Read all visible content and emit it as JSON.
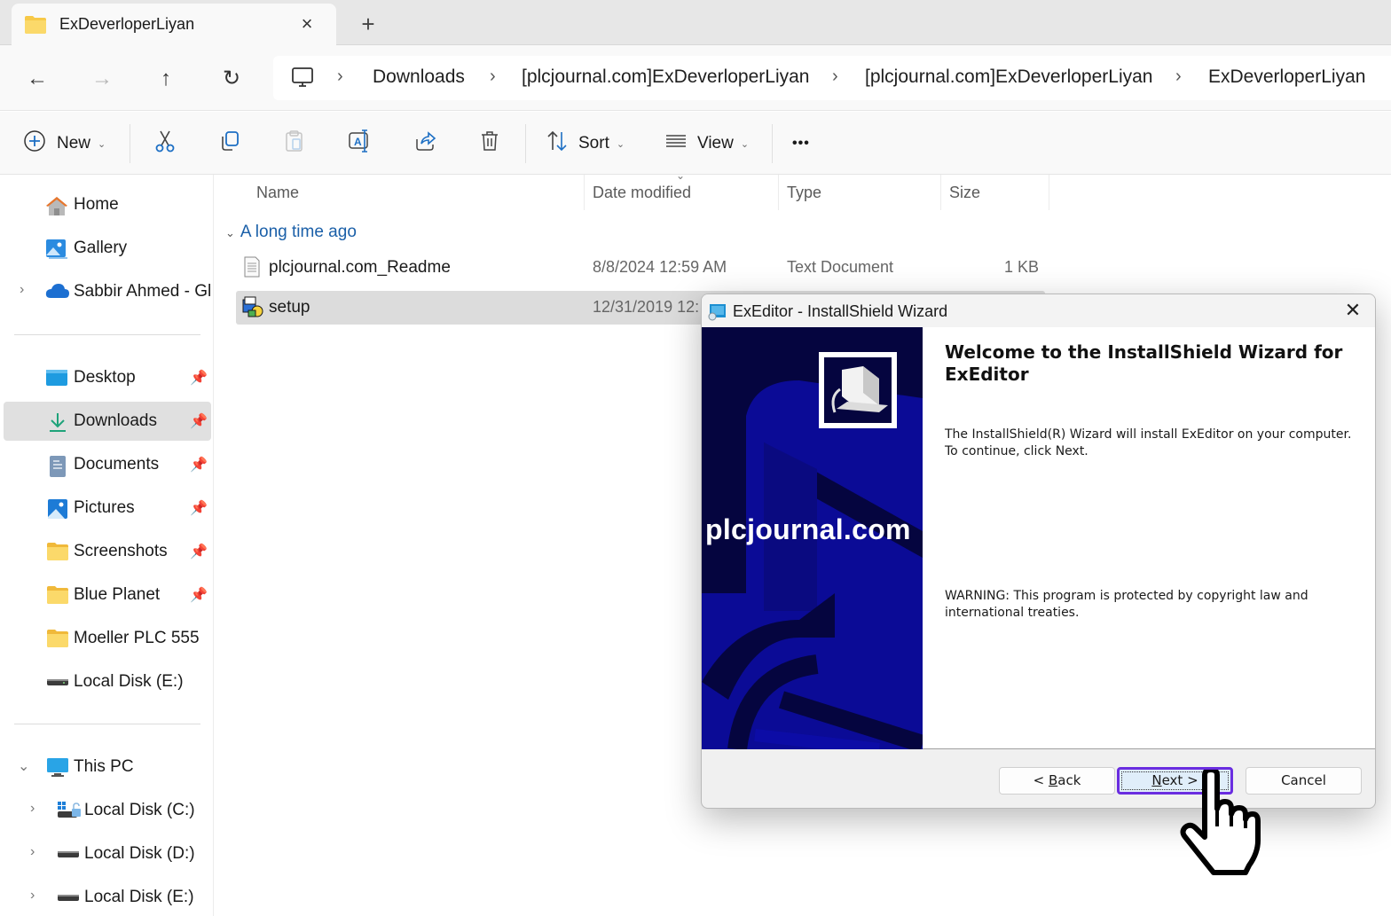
{
  "window": {
    "tab_title": "ExDeverloperLiyan",
    "tab_close_icon": "×",
    "new_tab_icon": "+"
  },
  "nav": {
    "back_icon": "←",
    "forward_icon": "→",
    "up_icon": "↑",
    "refresh_icon": "↻",
    "breadcrumbs": [
      "Downloads",
      "[plcjournal.com]ExDeverloperLiyan",
      "[plcjournal.com]ExDeverloperLiyan",
      "ExDeverloperLiyan"
    ],
    "separator": "›"
  },
  "toolbar": {
    "new_label": "New",
    "sort_label": "Sort",
    "view_label": "View",
    "more_icon": "•••",
    "dropdown_icon": "⌄"
  },
  "sidebar": {
    "top_items": [
      {
        "label": "Home",
        "icon": "home-icon"
      },
      {
        "label": "Gallery",
        "icon": "gallery-icon"
      },
      {
        "label": "Sabbir Ahmed - Global",
        "icon": "onedrive-cloud-icon",
        "expandable": true
      }
    ],
    "quick_access": [
      {
        "label": "Desktop",
        "icon": "desktop-icon",
        "pinned": true
      },
      {
        "label": "Downloads",
        "icon": "downloads-icon",
        "pinned": true,
        "selected": true
      },
      {
        "label": "Documents",
        "icon": "documents-icon",
        "pinned": true
      },
      {
        "label": "Pictures",
        "icon": "pictures-icon",
        "pinned": true
      },
      {
        "label": "Screenshots",
        "icon": "folder-icon",
        "pinned": true
      },
      {
        "label": "Blue Planet",
        "icon": "folder-icon",
        "pinned": true
      },
      {
        "label": "Moeller PLC 555",
        "icon": "folder-icon",
        "pinned": false
      },
      {
        "label": "Local Disk (E:)",
        "icon": "drive-icon",
        "pinned": false
      }
    ],
    "this_pc": {
      "label": "This PC",
      "children": [
        {
          "label": "Local Disk (C:)",
          "icon": "system-drive-icon"
        },
        {
          "label": "Local Disk (D:)",
          "icon": "drive-icon"
        },
        {
          "label": "Local Disk (E:)",
          "icon": "drive-icon"
        }
      ]
    },
    "pin_icon": "📌",
    "expand_icon": "›",
    "collapse_icon": "⌄"
  },
  "file_list": {
    "columns": [
      "Name",
      "Date modified",
      "Type",
      "Size"
    ],
    "sort_indicator": "⌄",
    "group_label": "A long time ago",
    "rows": [
      {
        "name": "plcjournal.com_Readme",
        "date": "8/8/2024 12:59 AM",
        "type": "Text Document",
        "size": "1 KB",
        "icon": "text-file-icon",
        "selected": false
      },
      {
        "name": "setup",
        "date": "12/31/2019 12:",
        "type": "",
        "size": "",
        "icon": "setup-exe-icon",
        "selected": true
      }
    ]
  },
  "dialog": {
    "title": "ExEditor - InstallShield Wizard",
    "close_icon": "✕",
    "banner_text": "plcjournal.com",
    "heading": "Welcome to the InstallShield Wizard for ExEditor",
    "body": "The InstallShield(R) Wizard will install ExEditor on your computer. To continue, click Next.",
    "warning": "WARNING: This program is protected by copyright law and international treaties.",
    "buttons": {
      "back": {
        "prefix": "< ",
        "accel": "B",
        "rest": "ack"
      },
      "next": {
        "prefix": "",
        "accel": "N",
        "rest": "ext >"
      },
      "cancel": "Cancel"
    },
    "colors": {
      "banner_dark": "#05053f",
      "banner_light": "#0b0b9a",
      "focus_border": "#6a2de0"
    }
  }
}
